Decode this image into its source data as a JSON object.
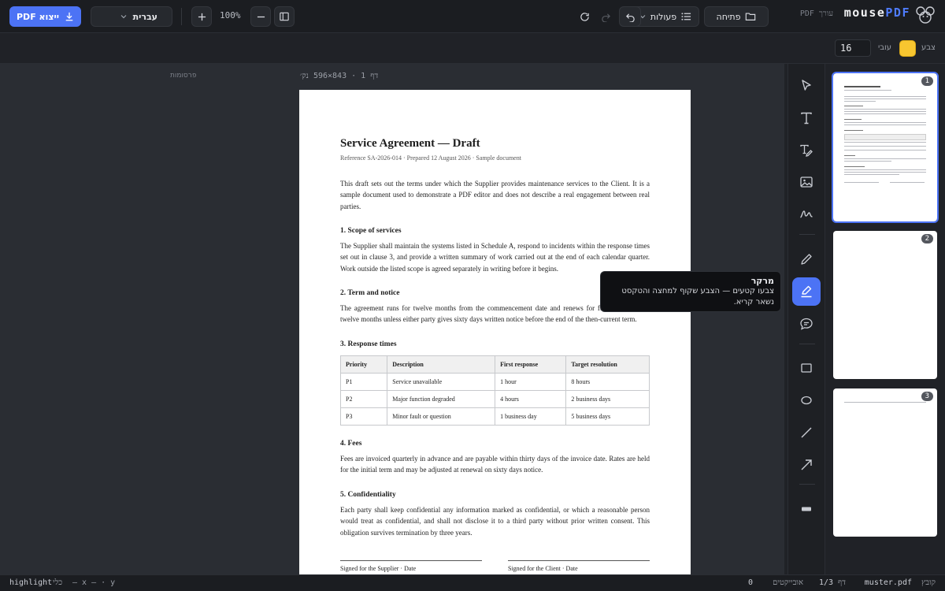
{
  "app": {
    "brand_main": "mouse",
    "brand_accent": "PDF",
    "subtitle": "עורך PDF",
    "accent": "#4c73f5"
  },
  "topbar": {
    "open_label": "פתיחה",
    "actions_label": "פעולות",
    "zoom_value": "100%",
    "language_label": "עברית",
    "export_label": "ייצוא PDF"
  },
  "toolbar2": {
    "color_label": "צבע",
    "color_value": "#f8c630",
    "thickness_label": "עובי",
    "thickness_value": "16"
  },
  "tools": [
    {
      "name": "select-tool",
      "icon": "cursor-icon"
    },
    {
      "name": "text-tool",
      "icon": "text-icon"
    },
    {
      "name": "edit-text-tool",
      "icon": "text-edit-icon"
    },
    {
      "name": "image-tool",
      "icon": "image-icon"
    },
    {
      "name": "signature-tool",
      "icon": "signature-icon"
    },
    {
      "name": "pen-tool",
      "icon": "pencil-icon"
    },
    {
      "name": "highlighter-tool",
      "icon": "highlighter-icon",
      "active": true
    },
    {
      "name": "comment-tool",
      "icon": "comment-icon"
    },
    {
      "name": "rectangle-tool",
      "icon": "rectangle-icon"
    },
    {
      "name": "ellipse-tool",
      "icon": "ellipse-icon"
    },
    {
      "name": "line-tool",
      "icon": "line-icon"
    },
    {
      "name": "arrow-tool",
      "icon": "arrow-icon"
    },
    {
      "name": "redact-tool",
      "icon": "redact-icon"
    }
  ],
  "tooltip": {
    "title": "מרקר",
    "body": "צבעו קטעים — הצבע שקוף למחצה והטקסט נשאר קריא."
  },
  "canvas": {
    "ads_label": "פרסומות",
    "page_info": "דף 1 · 843×596 נק׳"
  },
  "document": {
    "title": "Service Agreement — Draft",
    "subtitle": "Reference SA-2026-014 · Prepared 12 August 2026 · Sample document",
    "intro": "This draft sets out the terms under which the Supplier provides maintenance services to the Client. It is a sample document used to demonstrate a PDF editor and does not describe a real engagement between real parties.",
    "s1_heading": "1. Scope of services",
    "s1_body": "The Supplier shall maintain the systems listed in Schedule A, respond to incidents within the response times set out in clause 3, and provide a written summary of work carried out at the end of each calendar quarter. Work outside the listed scope is agreed separately in writing before it begins.",
    "s2_heading": "2. Term and notice",
    "s2_body": "The agreement runs for twelve months from the commencement date and renews for further periods of twelve months unless either party gives sixty days written notice before the end of the then-current term.",
    "s3_heading": "3. Response times",
    "table_headers": [
      "Priority",
      "Description",
      "First response",
      "Target resolution"
    ],
    "table_rows": [
      [
        "P1",
        "Service unavailable",
        "1 hour",
        "8 hours"
      ],
      [
        "P2",
        "Major function degraded",
        "4 hours",
        "2 business days"
      ],
      [
        "P3",
        "Minor fault or question",
        "1 business day",
        "5 business days"
      ]
    ],
    "s4_heading": "4. Fees",
    "s4_body": "Fees are invoiced quarterly in advance and are payable within thirty days of the invoice date. Rates are held for the initial term and may be adjusted at renewal on sixty days notice.",
    "s5_heading": "5. Confidentiality",
    "s5_body": "Each party shall keep confidential any information marked as confidential, or which a reasonable person would treat as confidential, and shall not disclose it to a third party without prior written consent. This obligation survives termination by three years.",
    "sig_supplier": "Signed for the Supplier · Date",
    "sig_client": "Signed for the Client · Date"
  },
  "thumbnails": [
    {
      "num": "1",
      "selected": true
    },
    {
      "num": "2"
    },
    {
      "num": "3"
    }
  ],
  "status": {
    "file_label": "קובץ",
    "file_value": "muster.pdf",
    "page_label": "דף",
    "page_value": "1/3",
    "objects_label": "אובייקטים",
    "objects_value": "0",
    "tool_label": "כלי",
    "tool_value": "highlight",
    "coords": "— x — · y"
  }
}
